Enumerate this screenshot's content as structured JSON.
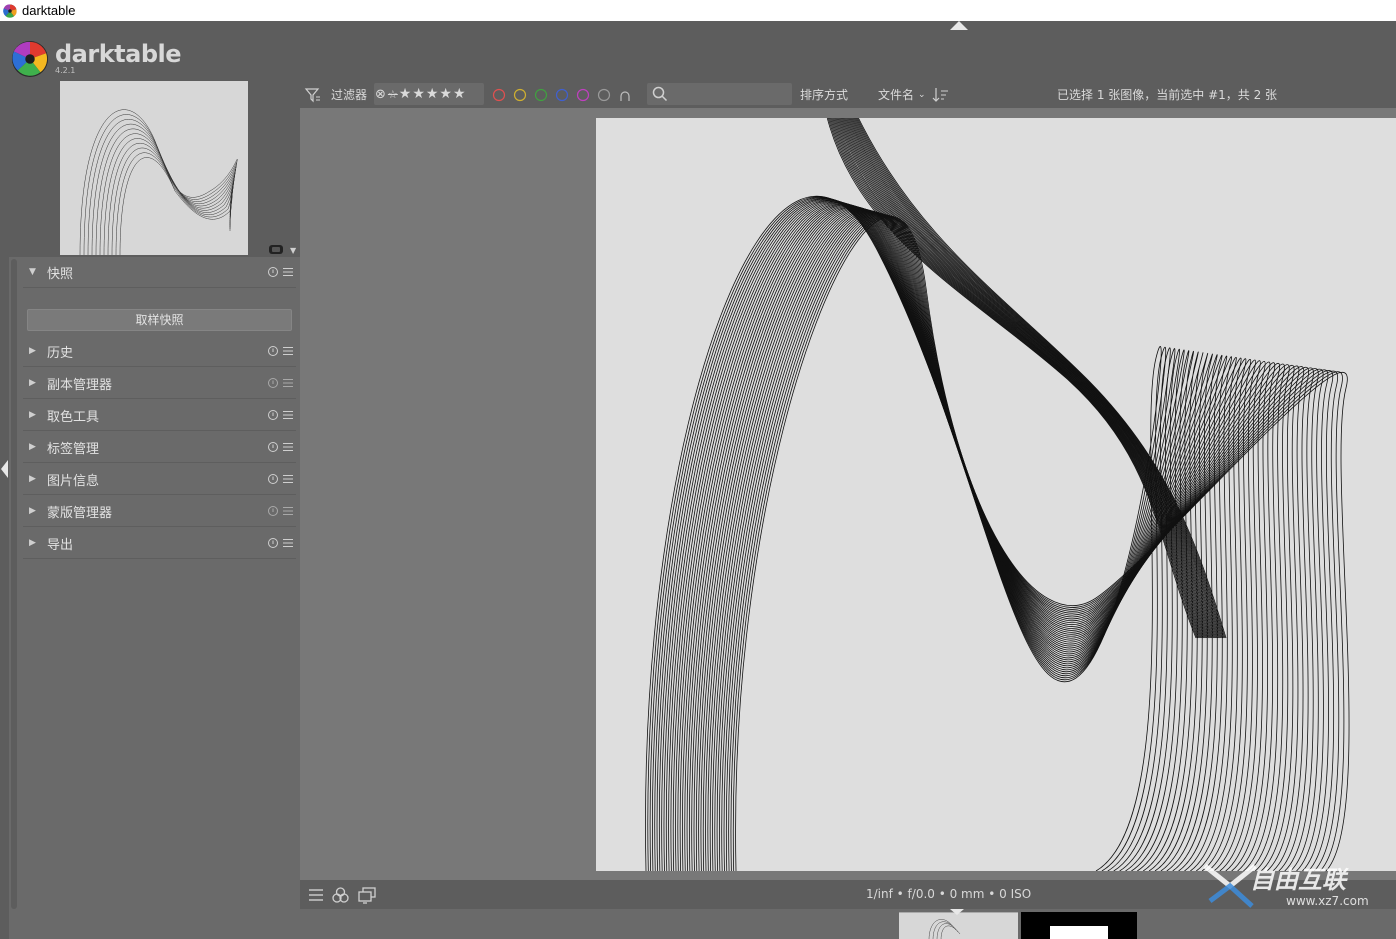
{
  "window": {
    "title": "darktable"
  },
  "header": {
    "brand": "darktable",
    "version": "4.2.1"
  },
  "filterbar": {
    "filter_label": "过滤器",
    "rating_symbols": "★★★★★",
    "color_labels": [
      "#e05050",
      "#d0b030",
      "#40a040",
      "#4060d0",
      "#c040c0"
    ],
    "sort_label": "排序方式",
    "sort_value": "文件名",
    "search": {
      "placeholder": "",
      "value": ""
    },
    "selection_status": "已选择 1 张图像，当前选中 #1，共 2 张"
  },
  "left_panel": {
    "snapshots": {
      "label": "快照",
      "button": "取样快照",
      "expanded": true
    },
    "modules": [
      {
        "label": "历史"
      },
      {
        "label": "副本管理器"
      },
      {
        "label": "取色工具"
      },
      {
        "label": "标签管理"
      },
      {
        "label": "图片信息"
      },
      {
        "label": "蒙版管理器"
      },
      {
        "label": "导出"
      }
    ]
  },
  "bottom": {
    "exif": "1/inf • f/0.0 • 0 mm • 0 ISO"
  },
  "watermark": {
    "text": "自由互联",
    "url": "www.xz7.com"
  }
}
